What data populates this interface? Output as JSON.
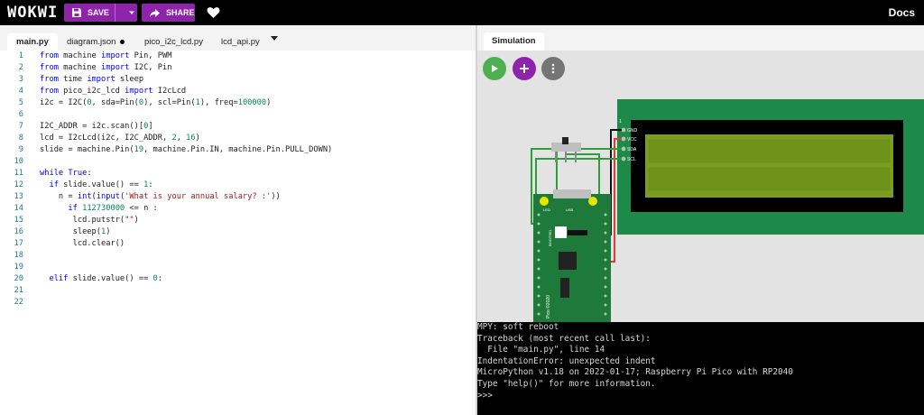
{
  "topbar": {
    "logo": "WOKWI",
    "save_label": "SAVE",
    "share_label": "SHARE",
    "docs_label": "Docs"
  },
  "editor": {
    "tabs": [
      {
        "label": "main.py",
        "active": true
      },
      {
        "label": "diagram.json",
        "modified": true
      },
      {
        "label": "pico_i2c_lcd.py"
      },
      {
        "label": "lcd_api.py"
      }
    ],
    "lines": [
      "from machine import Pin, PWM",
      "from machine import I2C, Pin",
      "from time import sleep",
      "from pico_i2c_lcd import I2cLcd",
      "i2c = I2C(0, sda=Pin(0), scl=Pin(1), freq=100000)",
      "",
      "I2C_ADDR = i2c.scan()[0]",
      "lcd = I2cLcd(i2c, I2C_ADDR, 2, 16)",
      "slide = machine.Pin(19, machine.Pin.IN, machine.Pin.PULL_DOWN)",
      "",
      "while True:",
      "  if slide.value() == 1:",
      "    n = int(input('What is your annual salary? :'))",
      "      if 112730000 <= n :",
      "       lcd.putstr(\"\")",
      "       sleep(1)",
      "       lcd.clear()",
      "",
      "",
      "  elif slide.value() == 0:",
      "",
      ""
    ]
  },
  "simulation": {
    "tab_label": "Simulation",
    "lcd_pins": [
      "1",
      "GND",
      "VCC",
      "SDA",
      "SCL"
    ],
    "pico_labels": [
      "LED",
      "USB",
      "BOOTSEL",
      "Pico ©2020"
    ],
    "colors": {
      "lcd_screen": "#7a9d1f",
      "lcd_board": "#1e8a4a",
      "pico_board": "#1e7a3a",
      "wire_red": "#e53935",
      "wire_green": "#2e9d3a",
      "wire_black": "#111111"
    }
  },
  "console": {
    "lines": [
      "MPY: soft reboot",
      "Traceback (most recent call last):",
      "  File \"main.py\", line 14",
      "IndentationError: unexpected indent",
      "MicroPython v1.18 on 2022-01-17; Raspberry Pi Pico with RP2040",
      "Type \"help()\" for more information.",
      ">>>"
    ]
  }
}
